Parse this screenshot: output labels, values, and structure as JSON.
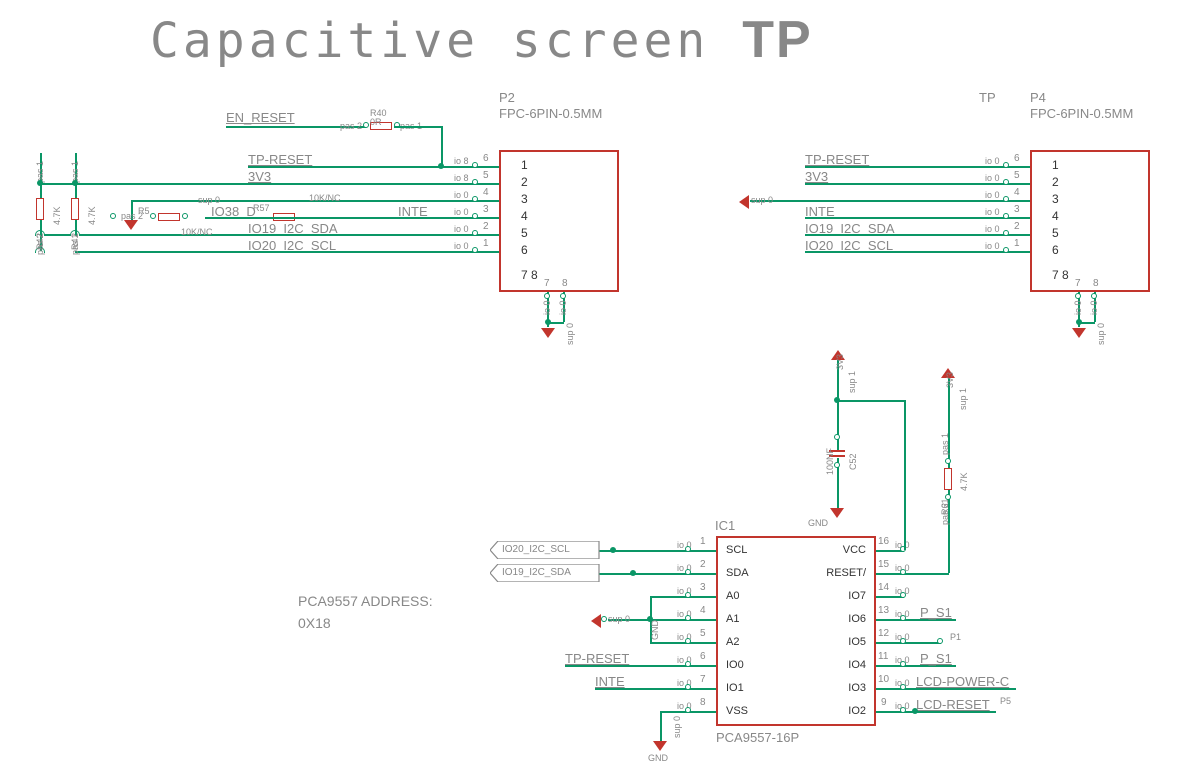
{
  "title": {
    "main": "Capacitive screen",
    "suffix": "TP"
  },
  "connectors": {
    "p2": {
      "ref": "P2",
      "footprint": "FPC-6PIN-0.5MM",
      "nets": [
        "TP-RESET",
        "3V3",
        "",
        "INTE",
        "IO19_I2C_SDA",
        "IO20_I2C_SCL"
      ],
      "pinmap": [
        "6",
        "5",
        "4",
        "3",
        "2",
        "1",
        "7",
        "8"
      ],
      "box_nums": [
        "1",
        "2",
        "3",
        "4",
        "5",
        "6",
        "7  8"
      ],
      "reset_src": "EN_RESET",
      "r40": {
        "name": "R40",
        "value": "0R"
      }
    },
    "p4": {
      "ref": "P4",
      "title": "TP",
      "footprint": "FPC-6PIN-0.5MM",
      "nets": [
        "TP-RESET",
        "3V3",
        "",
        "INTE",
        "IO19_I2C_SDA",
        "IO20_I2C_SCL"
      ],
      "pinmap": [
        "6",
        "5",
        "4",
        "3",
        "2",
        "1",
        "7",
        "8"
      ],
      "box_nums": [
        "1",
        "2",
        "3",
        "4",
        "5",
        "6",
        "7  8"
      ]
    }
  },
  "pullups": {
    "r42": {
      "name": "R42",
      "value": "4.7K"
    },
    "r41": {
      "name": "R41",
      "value": "4.7K"
    },
    "r57": {
      "name": "R57",
      "value": "10K/NC",
      "net_left": "IO38_D"
    },
    "r5": {
      "name": "R5",
      "value": "10K/NC"
    }
  },
  "ic1": {
    "ref": "IC1",
    "part": "PCA9557-16P",
    "note_line1": "PCA9557 ADDRESS:",
    "note_line2": "0X18",
    "pins_left": [
      {
        "num": "1",
        "label": "SCL",
        "net": "IO20_I2C_SCL"
      },
      {
        "num": "2",
        "label": "SDA",
        "net": "IO19_I2C_SDA"
      },
      {
        "num": "3",
        "label": "A0"
      },
      {
        "num": "4",
        "label": "A1"
      },
      {
        "num": "5",
        "label": "A2"
      },
      {
        "num": "6",
        "label": "IO0",
        "net": "TP-RESET"
      },
      {
        "num": "7",
        "label": "IO1",
        "net": "INTE"
      },
      {
        "num": "8",
        "label": "VSS"
      }
    ],
    "pins_right": [
      {
        "num": "16",
        "label": "VCC"
      },
      {
        "num": "15",
        "label": "RESET/"
      },
      {
        "num": "14",
        "label": "IO7"
      },
      {
        "num": "13",
        "label": "IO6",
        "net": "P_S1"
      },
      {
        "num": "12",
        "label": "IO5",
        "net2": "P1"
      },
      {
        "num": "11",
        "label": "IO4",
        "net": "P_S1"
      },
      {
        "num": "10",
        "label": "IO3",
        "net": "LCD-POWER-C"
      },
      {
        "num": "9",
        "label": "IO2",
        "net": "LCD-RESET",
        "net2": "P5"
      }
    ],
    "decoupling": {
      "c52": {
        "name": "C52",
        "value": "100NF"
      },
      "r61": {
        "name": "R61",
        "value": "4.7K"
      }
    },
    "gnd_labels": {
      "left": "GND",
      "bottom": "GND",
      "top": "GND"
    },
    "pwr": "3V3"
  }
}
